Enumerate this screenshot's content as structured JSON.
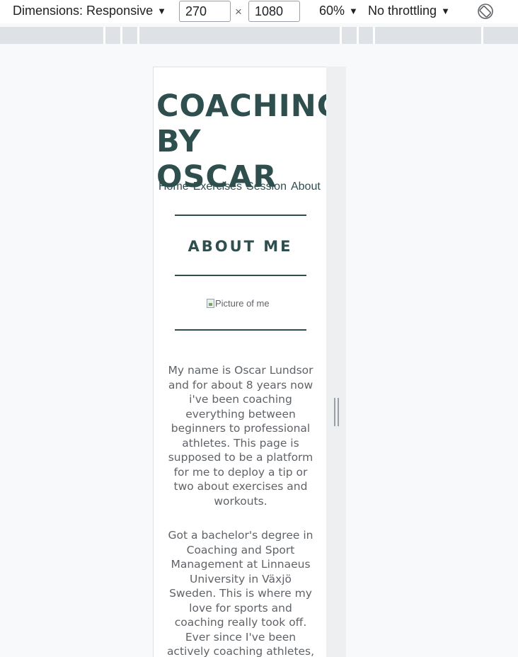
{
  "toolbar": {
    "dimensions_label": "Dimensions: Responsive",
    "width_value": "270",
    "height_value": "1080",
    "times_symbol": "×",
    "zoom_label": "60%",
    "throttle_label": "No throttling",
    "dropdown_arrow": "▼",
    "rotate_icon": "rotate-icon"
  },
  "site": {
    "title_line1": "COACHING",
    "title_line2": "BY OSCAR",
    "nav": [
      "Home",
      "Exercises",
      "Session",
      "About"
    ],
    "section_heading": "ABOUT ME",
    "image_alt": "Picture of me",
    "paragraph1": "My name is Oscar Lundsor and for about 8 years now i've been coaching everything between beginners to professional athletes. This page is supposed to be a platform for me to deploy a tip or two about exercises and workouts.",
    "paragraph2": "Got a bachelor's degree in Coaching and Sport Management at Linnaeus University in Växjö Sweden. This is where my love for sports and coaching really took off. Ever since I've been actively coaching athletes, and my main focus has been"
  },
  "colors": {
    "brand": "#2f4f4f",
    "text_muted": "#5f6368",
    "canvas_bg": "#f8f9fa"
  }
}
